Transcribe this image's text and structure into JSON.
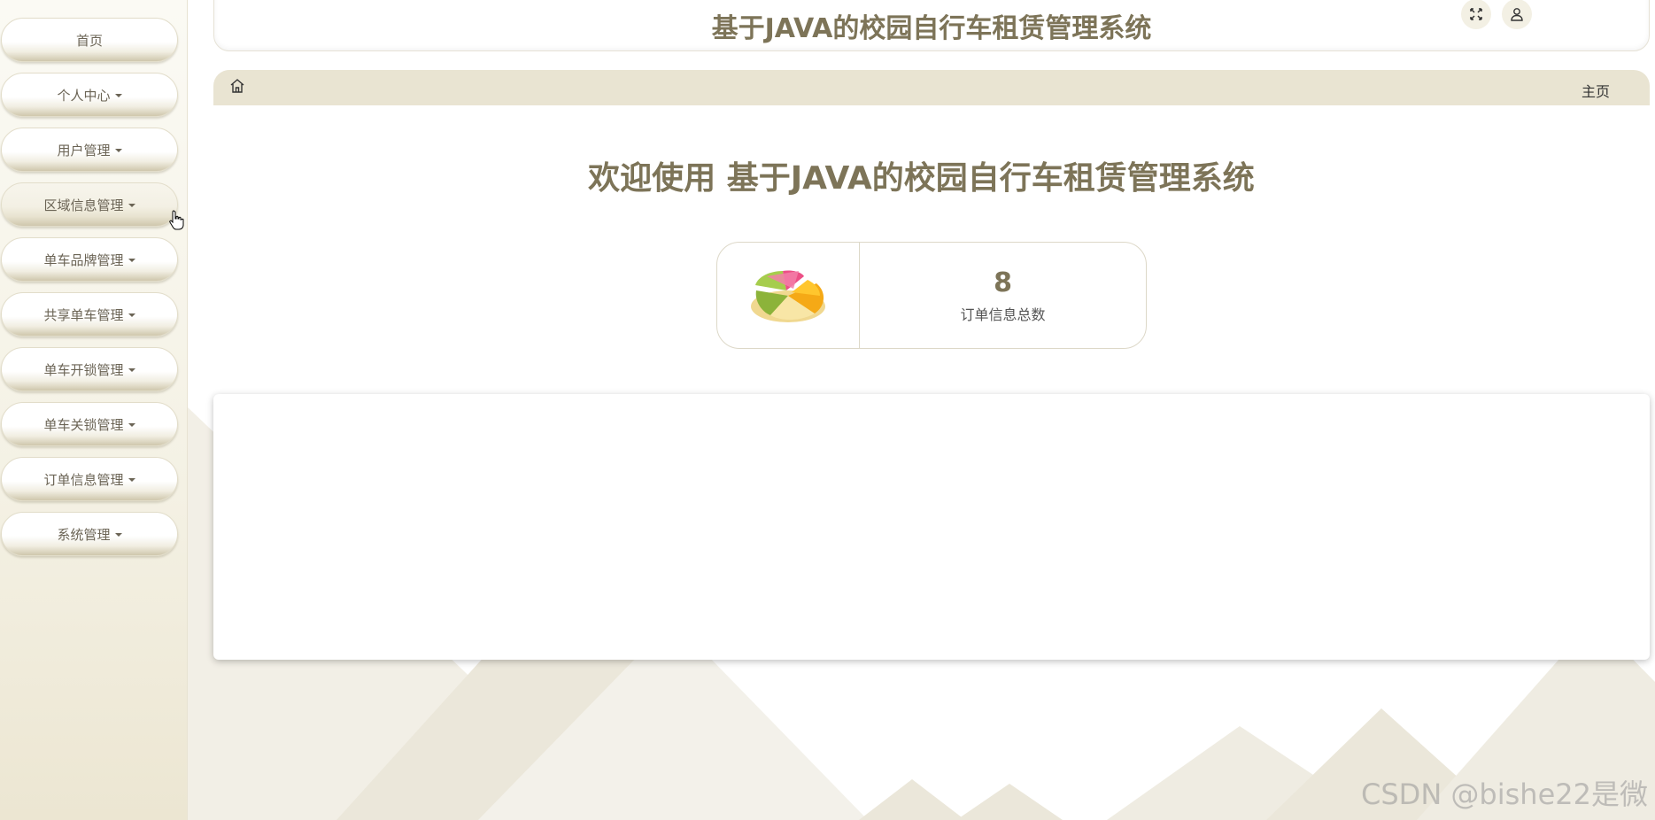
{
  "header": {
    "title": "基于JAVA的校园自行车租赁管理系统"
  },
  "sidebar": {
    "items": [
      {
        "label": "首页",
        "dropdown": false
      },
      {
        "label": "个人中心",
        "dropdown": true
      },
      {
        "label": "用户管理",
        "dropdown": true
      },
      {
        "label": "区域信息管理",
        "dropdown": true
      },
      {
        "label": "单车品牌管理",
        "dropdown": true
      },
      {
        "label": "共享单车管理",
        "dropdown": true
      },
      {
        "label": "单车开锁管理",
        "dropdown": true
      },
      {
        "label": "单车关锁管理",
        "dropdown": true
      },
      {
        "label": "订单信息管理",
        "dropdown": true
      },
      {
        "label": "系统管理",
        "dropdown": true
      }
    ]
  },
  "breadcrumb": {
    "current": "主页"
  },
  "main": {
    "welcome": "欢迎使用 基于JAVA的校园自行车租赁管理系统",
    "stat": {
      "value": "8",
      "label": "订单信息总数"
    }
  },
  "watermark": "CSDN @bishe22是微",
  "colors": {
    "accent": "#7d7458",
    "breadcrumb_bg": "#e9e4d2",
    "sidebar_bg": "#f4f1e4"
  }
}
